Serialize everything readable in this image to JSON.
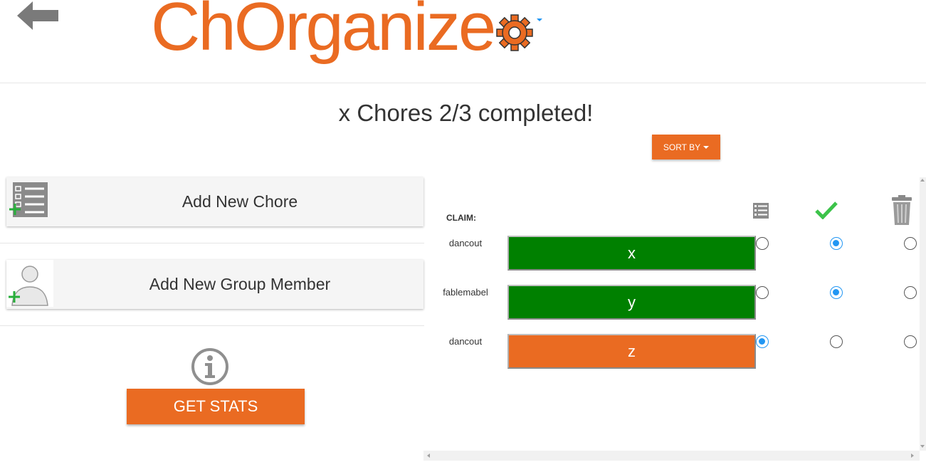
{
  "header": {
    "brand": "ChOrganize",
    "back_icon": "back-arrow-icon",
    "settings_icon": "gear-icon",
    "brand_color": "#ea6b22"
  },
  "title": "x Chores 2/3 completed!",
  "sort_button": {
    "label": "SORT BY"
  },
  "left_panel": {
    "add_chore_label": "Add New Chore",
    "add_member_label": "Add New Group Member",
    "stats_button_label": "GET STATS",
    "info_icon": "info-icon"
  },
  "table": {
    "claim_label": "CLAIM:",
    "columns": [
      {
        "icon": "checklist-icon"
      },
      {
        "icon": "checkmark-icon"
      },
      {
        "icon": "trash-icon"
      }
    ],
    "rows": [
      {
        "member": "dancout",
        "chore": "x",
        "status_color": "#008000",
        "selected_column": 1
      },
      {
        "member": "fablemabel",
        "chore": "y",
        "status_color": "#008000",
        "selected_column": 1
      },
      {
        "member": "dancout",
        "chore": "z",
        "status_color": "#ea6b22",
        "selected_column": 0
      }
    ]
  }
}
